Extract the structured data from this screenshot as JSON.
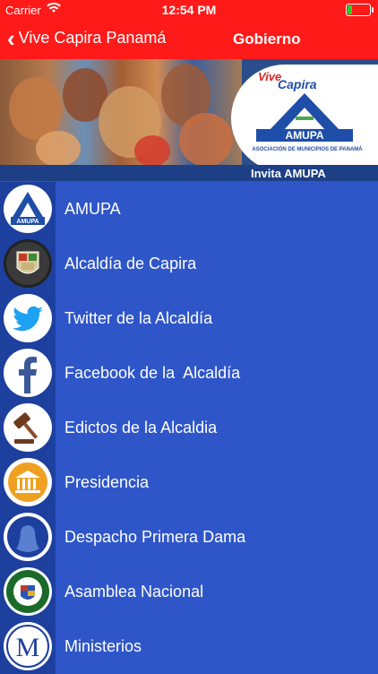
{
  "status_bar": {
    "carrier": "Carrier",
    "time": "12:54 PM"
  },
  "nav": {
    "back_label": "Vive Capira Panamá",
    "title": "Gobierno"
  },
  "banner": {
    "vive": "Vive",
    "capira": "Capira",
    "logo_text": "AMUPA",
    "assoc": "ASOCIACIÓN DE MUNICIPIOS DE PANAMÁ",
    "invite": "Invita  AMUPA"
  },
  "items": [
    {
      "label": "AMUPA",
      "icon": "amupa-logo-icon"
    },
    {
      "label": "Alcaldía de Capira",
      "icon": "capira-seal-icon"
    },
    {
      "label": "Twitter de la Alcaldía",
      "icon": "twitter-bird-icon"
    },
    {
      "label": "Facebook de la  Alcaldía",
      "icon": "facebook-f-icon"
    },
    {
      "label": "Edictos de la Alcaldia",
      "icon": "gavel-icon"
    },
    {
      "label": "Presidencia",
      "icon": "government-building-icon"
    },
    {
      "label": "Despacho Primera Dama",
      "icon": "woman-silhouette-icon"
    },
    {
      "label": "Asamblea Nacional",
      "icon": "asamblea-seal-icon"
    },
    {
      "label": "Ministerios",
      "icon": "letter-m-icon"
    }
  ],
  "colors": {
    "nav": "#ff1a1a",
    "list_bg": "#2f56c9",
    "icon_column": "#1d3f9e",
    "brand_blue": "#1f4ea8"
  }
}
